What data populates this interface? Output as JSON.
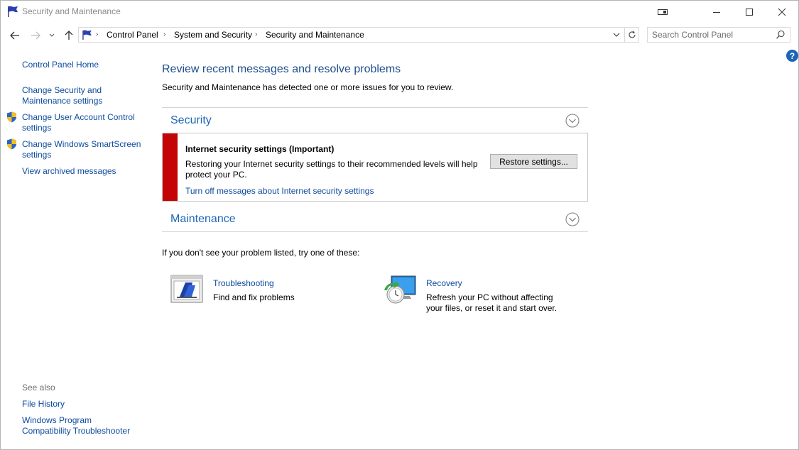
{
  "window": {
    "title": "Security and Maintenance"
  },
  "nav": {
    "breadcrumbs": [
      "Control Panel",
      "System and Security",
      "Security and Maintenance"
    ],
    "search_placeholder": "Search Control Panel"
  },
  "help": {
    "label": "?"
  },
  "sidebar": {
    "items": [
      {
        "line1": "Control Panel Home",
        "line2": ""
      },
      {
        "line1": "Change Security and",
        "line2": "Maintenance settings"
      },
      {
        "line1": "Change User Account Control",
        "line2": "settings"
      },
      {
        "line1": "Change Windows SmartScreen",
        "line2": "settings"
      },
      {
        "line1": "View archived messages",
        "line2": ""
      }
    ],
    "see_also_label": "See also",
    "see_also": [
      {
        "line1": "File History",
        "line2": ""
      },
      {
        "line1": "Windows Program",
        "line2": "Compatibility Troubleshooter"
      }
    ]
  },
  "main": {
    "heading": "Review recent messages and resolve problems",
    "subheading": "Security and Maintenance has detected one or more issues for you to review.",
    "security": {
      "title": "Security",
      "alert": {
        "title": "Internet security settings  (Important)",
        "description": "Restoring your Internet security settings to their recommended levels will help protect your PC.",
        "link": "Turn off messages about Internet security settings",
        "button": "Restore settings...",
        "stripe_color": "#c50505"
      }
    },
    "maintenance": {
      "title": "Maintenance"
    },
    "try_text": "If you don't see your problem listed, try one of these:",
    "tools": [
      {
        "title": "Troubleshooting",
        "desc1": "Find and fix problems",
        "desc2": "",
        "icon": "troubleshooting-icon"
      },
      {
        "title": "Recovery",
        "desc1": "Refresh your PC without affecting",
        "desc2": "your files, or reset it and start over.",
        "icon": "recovery-icon"
      }
    ]
  }
}
